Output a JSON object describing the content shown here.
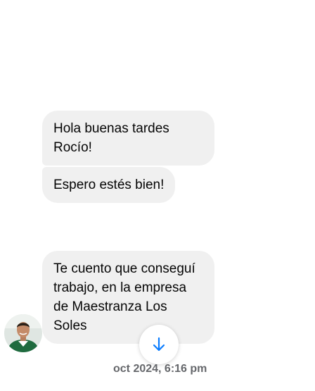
{
  "messages": [
    {
      "text": "Hola buenas tardes Rocío!"
    },
    {
      "text": "Espero estés bien!"
    },
    {
      "text": "Te cuento que conseguí trabajo, en la empresa de Maestranza Los Soles"
    }
  ],
  "timestamp": "oct 2024, 6:16 pm",
  "icons": {
    "scroll_down": "arrow-down-icon",
    "avatar": "contact-avatar"
  },
  "colors": {
    "bubble_bg": "#f0f0f0",
    "text": "#050505",
    "timestamp": "#65676b",
    "accent": "#0a7cff"
  }
}
